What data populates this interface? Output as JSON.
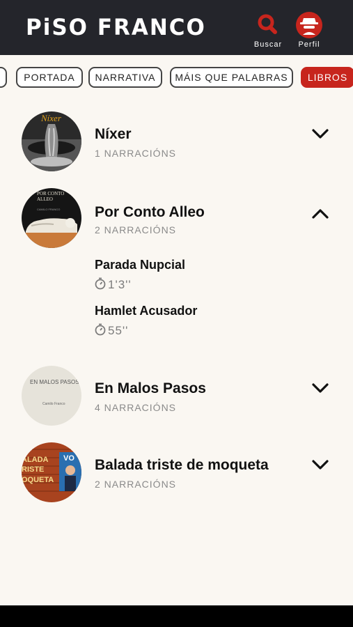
{
  "header": {
    "logo": "PiSO FRANCO",
    "search_label": "Buscar",
    "profile_label": "Perfil",
    "accent": "#c7251d",
    "background": "#24252b"
  },
  "nav": {
    "tabs": [
      {
        "label": ""
      },
      {
        "label": "PORTADA"
      },
      {
        "label": "NARRATIVA"
      },
      {
        "label": "MÁIS QUE PALABRAS"
      },
      {
        "label": "LIBROS",
        "active": true
      }
    ]
  },
  "books": [
    {
      "title": "Níxer",
      "count": "1 NARRACIÓNS",
      "cover_text": "Níxer",
      "expanded": false
    },
    {
      "title": "Por Conto Alleo",
      "count": "2 NARRACIÓNS",
      "cover_text": "POR CONTO ALLEO",
      "cover_author": "CAMILO FRANCO",
      "expanded": true,
      "tracks": [
        {
          "title": "Parada Nupcial",
          "duration": "1'3''"
        },
        {
          "title": "Hamlet Acusador",
          "duration": "55''"
        }
      ]
    },
    {
      "title": "En Malos Pasos",
      "count": "4 NARRACIÓNS",
      "cover_text": "EN MALOS PASOS",
      "cover_author": "Camilo Franco",
      "expanded": false
    },
    {
      "title": "Balada triste de moqueta",
      "count": "2 NARRACIÓNS",
      "cover_text": "BALADA TRISTE MOQUETA",
      "cover_badge": "VO",
      "expanded": false
    }
  ]
}
